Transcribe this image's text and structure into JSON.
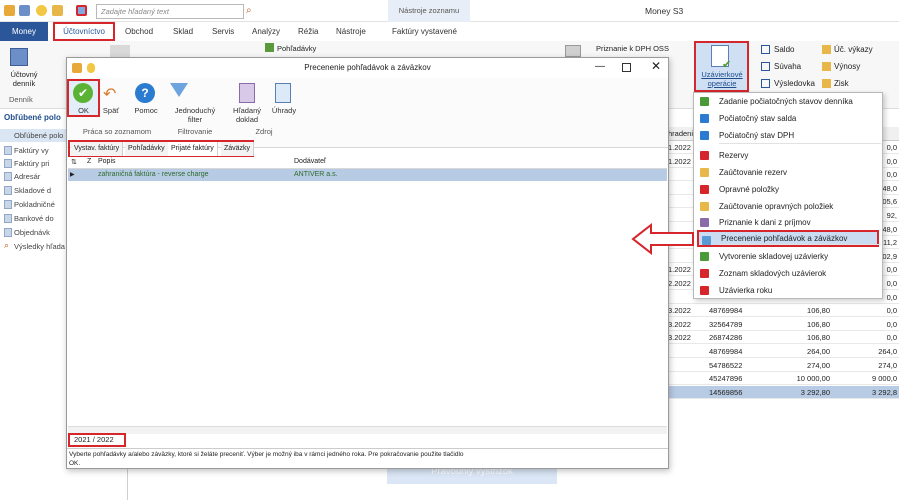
{
  "app": {
    "title": "Money S3",
    "context_tab": "Nástroje zoznamu",
    "search_placeholder": "Zadajte hľadaný text",
    "tab_money": "Money"
  },
  "tabs": [
    "Účtovníctvo",
    "Obchod",
    "Sklad",
    "Servis",
    "Analýzy",
    "Réžia",
    "Nástroje",
    "Faktúry vystavené"
  ],
  "ribbon": {
    "ucetny_dennik": "Účtovný denník",
    "dennik_group": "Denník",
    "pohladavky": "Pohľadávky",
    "priznanie_dph_oss": "Priznanie k DPH OSS",
    "uzavierkove_operacie": "Uzávierkové operácie",
    "saldo": "Saldo",
    "suvaha": "Súvaha",
    "vysledovka": "Výsledovka",
    "uct_vykazy": "Úč. výkazy",
    "vynosy": "Výnosy",
    "zisk": "Zisk"
  },
  "left_panel": {
    "header": "Obľúbené polo",
    "items": [
      "Obľúbené polo",
      "Faktúry vy",
      "Faktúry pri",
      "Adresár",
      "Skladové d",
      "Pokladničné",
      "Bankové do",
      "Objednávk",
      "Výsledky hľada"
    ]
  },
  "background_grid": {
    "col_header": "hradeni",
    "rows": [
      {
        "date": "1.2022",
        "num": "",
        "amt": "",
        "v": "0,0"
      },
      {
        "date": "1.2022",
        "num": "",
        "amt": "",
        "v": "0,0"
      },
      {
        "date": "",
        "num": "",
        "amt": "",
        "v": "0,0"
      },
      {
        "date": "",
        "num": "",
        "amt": "",
        "v": "48,0"
      },
      {
        "date": "",
        "num": "",
        "amt": "",
        "v": "105,6"
      },
      {
        "date": "",
        "num": "",
        "amt": "",
        "v": "92,"
      },
      {
        "date": "",
        "num": "",
        "amt": "",
        "v": "948,0"
      },
      {
        "date": "",
        "num": "",
        "amt": "",
        "v": "211,2"
      },
      {
        "date": "",
        "num": "",
        "amt": "",
        "v": "302,9"
      },
      {
        "date": "1.2022",
        "num": "",
        "amt": "",
        "v": "0,0"
      },
      {
        "date": "2.2022",
        "num": "",
        "amt": "",
        "v": "0,0"
      },
      {
        "date": "",
        "num": "",
        "amt": "",
        "v": "0,0"
      },
      {
        "date": "3.2022",
        "num": "48769984",
        "amt": "106,80",
        "v": "0,0"
      },
      {
        "date": "3.2022",
        "num": "32564789",
        "amt": "106,80",
        "v": "0,0"
      },
      {
        "date": "3.2022",
        "num": "26874286",
        "amt": "106,80",
        "v": "0,0"
      },
      {
        "date": "",
        "num": "48769984",
        "amt": "264,00",
        "v": "264,0"
      },
      {
        "date": "",
        "num": "54786522",
        "amt": "274,00",
        "v": "274,0"
      },
      {
        "date": "",
        "num": "45247896",
        "amt": "10 000,00",
        "v": "9 000,0"
      },
      {
        "date": "",
        "num": "14569856",
        "amt": "3 292,80",
        "v": "3 292,8"
      }
    ]
  },
  "dialog": {
    "title": "Precenenie pohľadávok a záväzkov",
    "buttons": {
      "ok": "OK",
      "spat": "Späť",
      "pomoc": "Pomoc",
      "filter": "Jednoduchý filter",
      "hladany": "Hľadaný doklad",
      "uhrady": "Úhrady"
    },
    "groups": {
      "praca": "Práca so zoznamom",
      "filtrovanie": "Filtrovanie",
      "zdroj": "Zdroj"
    },
    "tabs": [
      "Vystav. faktúry",
      "Pohľadávky",
      "Prijaté faktúry",
      "Záväzky"
    ],
    "columns": {
      "sort": "Z",
      "popis": "Popis",
      "dodavatel": "Dodávateľ"
    },
    "row": {
      "popis": "zahraničná faktúra - reverse charge",
      "dodavatel": "ANTIVER a.s."
    },
    "years": "2021 / 2022",
    "status": "Vyberte pohľadávky a/alebo záväzky, ktoré si želáte preceniť. Výber je možný iba v rámci jedného roka. Pre pokračovanie použite tlačidlo OK."
  },
  "menu": {
    "items": [
      "Zadanie počiatočných stavov denníka",
      "Počiatočný stav salda",
      "Počiatočný stav DPH",
      "Rezervy",
      "Zaúčtovanie rezerv",
      "Opravné položky",
      "Zaúčtovanie opravných položiek",
      "Priznanie k dani z príjmov",
      "Precenenie pohľadávok a záväzkov",
      "Vytvorenie skladovej uzávierky",
      "Zoznam skladových uzávierok",
      "Uzávierka roku"
    ]
  },
  "watermark": "Pravouhlý výstrižok",
  "colors": {
    "accent": "#2b579a",
    "highlight_red": "#d6262b",
    "selected_row": "#b8cbe4",
    "menu_highlight": "#c9dcf2"
  }
}
